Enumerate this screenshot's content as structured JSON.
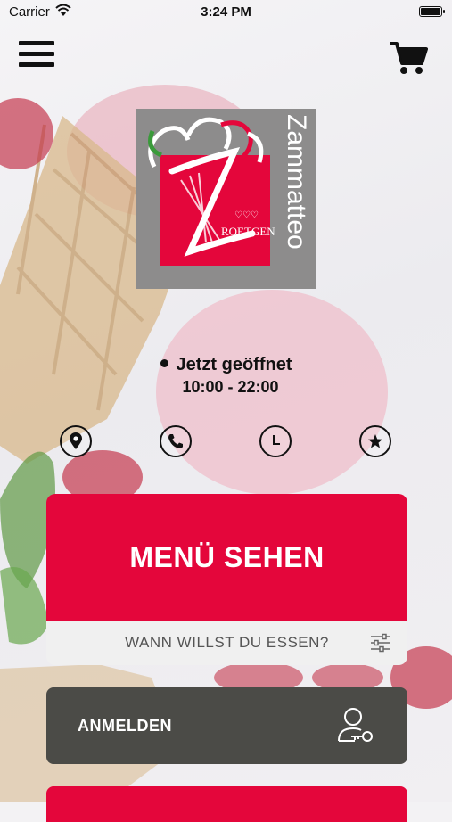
{
  "status_bar": {
    "carrier": "Carrier",
    "time": "3:24 PM"
  },
  "header": {
    "menu_icon": "hamburger-menu-icon",
    "cart_icon": "shopping-cart-icon"
  },
  "logo": {
    "brand": "Zammatteo",
    "location": "ROETGEN"
  },
  "store": {
    "status": "Jetzt geöffnet",
    "hours": "10:00 - 22:00"
  },
  "quick_actions": [
    {
      "icon": "location-pin-icon"
    },
    {
      "icon": "phone-icon"
    },
    {
      "icon": "clock-icon"
    },
    {
      "icon": "star-review-icon"
    }
  ],
  "menu": {
    "button_label": "MENÜ SEHEN",
    "time_prompt": "WANN WILLST DU ESSEN?"
  },
  "login": {
    "label": "ANMELDEN"
  },
  "colors": {
    "primary": "#e4063b",
    "dark_button": "#4b4b47",
    "logo_gray": "#8d8c8c"
  }
}
